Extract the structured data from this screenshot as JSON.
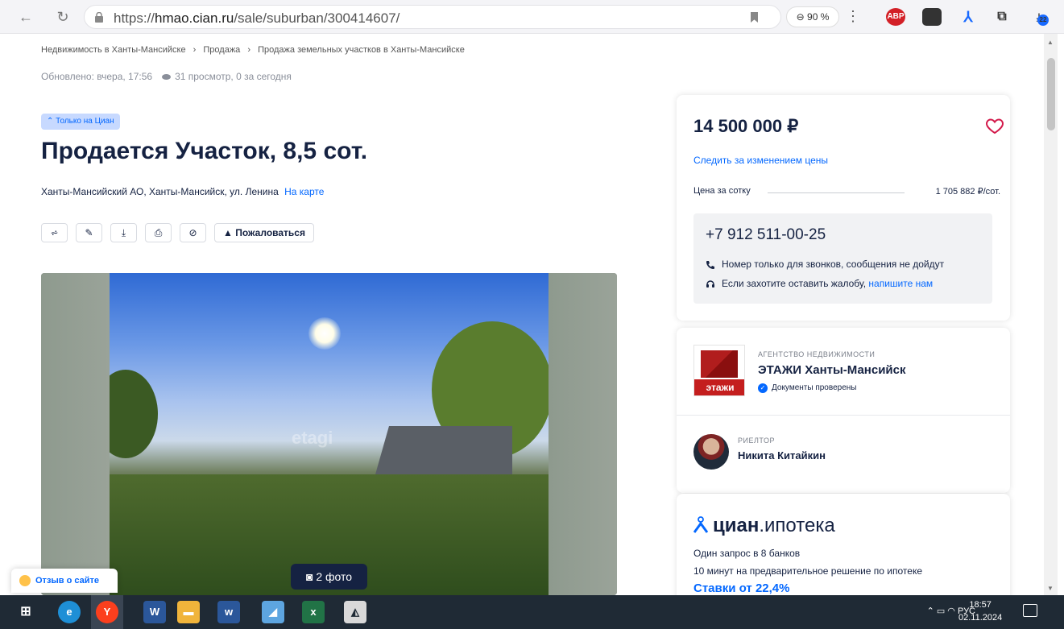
{
  "browser": {
    "url_prefix": "https://",
    "url_domain": "hmao.cian.ru",
    "url_path": "/sale/suburban/300414607/",
    "zoom": "90 %",
    "ext_abp": "ABP",
    "ext_badge": "22"
  },
  "breadcrumb": {
    "items": [
      "Недвижимость в Ханты-Мансийске",
      "Продажа",
      "Продажа земельных участков в Ханты-Мансийске"
    ],
    "sep": "›"
  },
  "meta": {
    "updated": "Обновлено: вчера, 17:56",
    "views": "31 просмотр, 0 за сегодня"
  },
  "listing": {
    "badge": "Только на Циан",
    "title": "Продается Участок, 8,5 сот.",
    "address": "Ханты-Мансийский АО, Ханты-Мансийск, ул. Ленина",
    "map_link": "На карте",
    "report_label": "Пожаловаться"
  },
  "gallery": {
    "photos_label": "2 фото",
    "watermark": "etagi"
  },
  "price_card": {
    "price": "14 500 000 ₽",
    "follow": "Следить за изменением цены",
    "per_label": "Цена за сотку",
    "per_value": "1 705 882 ₽/сот.",
    "phone": "+7 912 511-00-25",
    "note_calls": "Номер только для звонков, сообщения не дойдут",
    "note_complaint": "Если захотите оставить жалобу,",
    "note_link": "напишите нам"
  },
  "agency": {
    "kind": "АГЕНТСТВО НЕДВИЖИМОСТИ",
    "name": "ЭТАЖИ Ханты-Мансийск",
    "logo_text": "этажи",
    "verified": "Документы проверены",
    "realtor_kind": "РИЕЛТОР",
    "realtor_name": "Никита Китайкин"
  },
  "ipoteka": {
    "brand": "циан",
    "suffix": ".ипотека",
    "line1": "Один запрос в 8 банков",
    "line2": "10 минут на предварительное решение по ипотеке",
    "rate": "Ставки от 22,4%"
  },
  "feedback": {
    "label": "Отзыв о сайте"
  },
  "taskbar": {
    "lang": "РУС",
    "time": "18:57",
    "date": "02.11.2024"
  },
  "colors": {
    "accent": "#0468ff",
    "text": "#152242",
    "heart": "#d3194a"
  }
}
